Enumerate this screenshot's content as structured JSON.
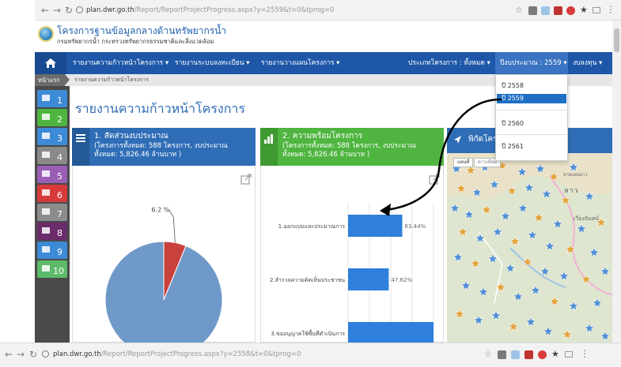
{
  "browser": {
    "top_url_host": "plan.dwr.go.th",
    "top_url_path": "/Report/ReportProjectProgress.aspx?y=2559&t=0&tprog=0",
    "bottom_url_host": "plan.dwr.go.th",
    "bottom_url_path": "/Report/ReportProjectProgress.aspx?y=2558&t=0&tprog=0"
  },
  "site": {
    "title": "โครงการฐานข้อมูลกลางด้านทรัพยากรน้ำ",
    "subtitle": "กรมทรัพยากรน้ำ กระทรวงทรัพยากรธรรมชาติและสิ่งแวดล้อม"
  },
  "nav": {
    "items": [
      "รายงานความก้าวหน้าโครงการ ▾",
      "รายงานระบบลงทะเบียน ▾",
      "รายงานวางแผนโครงการ ▾"
    ],
    "project_type": "ประเภทโครงการ : ทั้งหมด ▾",
    "fiscal_year": "ปีงบประมาณ : 2559 ▾",
    "budget": "งบลงทุน ▾"
  },
  "breadcrumb": {
    "home": "หน้าแรก",
    "current": "รายงานความก้าวหน้าโครงการ"
  },
  "fiscal_dropdown": {
    "options": [
      "ปี 2558",
      "ปี 2559",
      "ปี 2560",
      "ปี 2561"
    ],
    "selected": "ปี 2559"
  },
  "sidebar": {
    "buttons": [
      {
        "num": "1",
        "color": "#3d8ad6"
      },
      {
        "num": "2",
        "color": "#4fb540"
      },
      {
        "num": "3",
        "color": "#3d8ad6"
      },
      {
        "num": "4",
        "color": "#8a8a8a"
      },
      {
        "num": "5",
        "color": "#9a5fb5"
      },
      {
        "num": "6",
        "color": "#d83a3a"
      },
      {
        "num": "7",
        "color": "#8c8c8c"
      },
      {
        "num": "8",
        "color": "#6b2c6b"
      },
      {
        "num": "9",
        "color": "#3d8ad6"
      },
      {
        "num": "10",
        "color": "#5cba6a"
      }
    ]
  },
  "page": {
    "title": "รายงานความก้าวหน้าโครงการ"
  },
  "panels": {
    "budget": {
      "title": "1. สัดส่วนงบประมาณ",
      "subtitle": "(โครงการทั้งหมด: 588 โครงการ, งบประมาณทั้งหมด: 5,826.46 ล้านบาท )",
      "color": "#2f6db6",
      "icon_bg": "#255a98"
    },
    "readiness": {
      "title": "2. ความพร้อมโครงการ",
      "subtitle": "(โครงการทั้งหมด: 588 โครงการ, งบประมาณทั้งหมด: 5,826.46 ล้านบาท )",
      "color": "#4fb540",
      "icon_bg": "#3e9a31"
    },
    "map": {
      "title": "พิกัดโครงการ",
      "color": "#2f6db6",
      "chip_map": "แผนที่",
      "chip_sat": "ดาวเทียม",
      "label_laos": "ลาว",
      "label_small": "ชายแดนลาว",
      "label_city": "เวียงจันทน์"
    }
  },
  "chart_data": [
    {
      "type": "pie",
      "labels": [
        "6.2 %"
      ],
      "values": [
        6.2,
        93.8
      ],
      "colors": [
        "#c9413d",
        "#6f99c8"
      ]
    },
    {
      "type": "bar",
      "orientation": "horizontal",
      "categories": [
        "1.ออกแบบและประมาณการ",
        "2.สำรวจความคิดเห็นประชาชน",
        "3.ขออนุญาตใช้พื้นที่ดำเนินการ"
      ],
      "values": [
        63.44,
        47.62,
        100
      ],
      "value_labels": [
        "63.44%",
        "47.62%",
        ""
      ],
      "xlim": [
        0,
        100
      ],
      "color": "#2f7fdc"
    }
  ]
}
